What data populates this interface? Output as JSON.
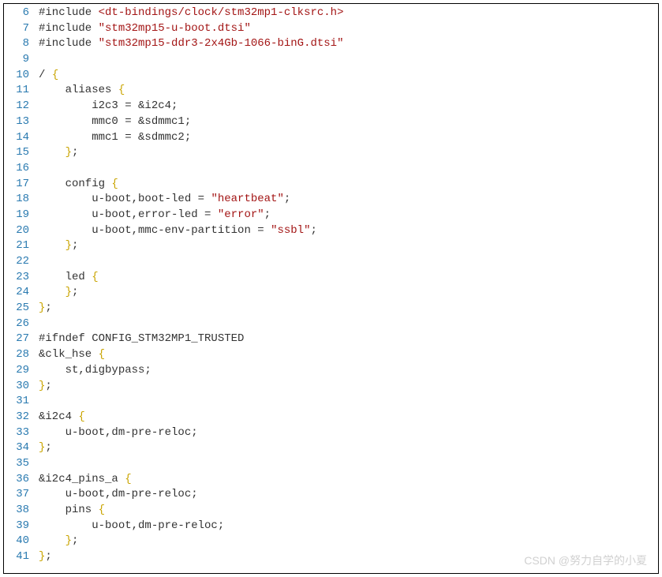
{
  "watermark": "CSDN @努力自学的小夏",
  "lines": [
    {
      "num": "6",
      "tokens": [
        {
          "t": "#include ",
          "c": "tok-pp"
        },
        {
          "t": "<dt-bindings/clock/stm32mp1-clksrc.h>",
          "c": "tok-inc"
        }
      ]
    },
    {
      "num": "7",
      "tokens": [
        {
          "t": "#include ",
          "c": "tok-pp"
        },
        {
          "t": "\"stm32mp15-u-boot.dtsi\"",
          "c": "tok-inc"
        }
      ]
    },
    {
      "num": "8",
      "tokens": [
        {
          "t": "#include ",
          "c": "tok-pp"
        },
        {
          "t": "\"stm32mp15-ddr3-2x4Gb-1066-binG.dtsi\"",
          "c": "tok-inc"
        }
      ]
    },
    {
      "num": "9",
      "tokens": []
    },
    {
      "num": "10",
      "tokens": [
        {
          "t": "/ ",
          "c": "tok-id"
        },
        {
          "t": "{",
          "c": "tok-brace"
        }
      ]
    },
    {
      "num": "11",
      "tokens": [
        {
          "t": "    aliases ",
          "c": "tok-id"
        },
        {
          "t": "{",
          "c": "tok-brace"
        }
      ]
    },
    {
      "num": "12",
      "tokens": [
        {
          "t": "        i2c3 = &i2c4;",
          "c": "tok-id"
        }
      ]
    },
    {
      "num": "13",
      "tokens": [
        {
          "t": "        mmc0 = &sdmmc1;",
          "c": "tok-id"
        }
      ]
    },
    {
      "num": "14",
      "tokens": [
        {
          "t": "        mmc1 = &sdmmc2;",
          "c": "tok-id"
        }
      ]
    },
    {
      "num": "15",
      "tokens": [
        {
          "t": "    ",
          "c": "tok-id"
        },
        {
          "t": "}",
          "c": "tok-brace"
        },
        {
          "t": ";",
          "c": "tok-punc"
        }
      ]
    },
    {
      "num": "16",
      "tokens": []
    },
    {
      "num": "17",
      "tokens": [
        {
          "t": "    config ",
          "c": "tok-id"
        },
        {
          "t": "{",
          "c": "tok-brace"
        }
      ]
    },
    {
      "num": "18",
      "tokens": [
        {
          "t": "        u-boot,boot-led = ",
          "c": "tok-id"
        },
        {
          "t": "\"heartbeat\"",
          "c": "tok-str"
        },
        {
          "t": ";",
          "c": "tok-punc"
        }
      ]
    },
    {
      "num": "19",
      "tokens": [
        {
          "t": "        u-boot,error-led = ",
          "c": "tok-id"
        },
        {
          "t": "\"error\"",
          "c": "tok-str"
        },
        {
          "t": ";",
          "c": "tok-punc"
        }
      ]
    },
    {
      "num": "20",
      "tokens": [
        {
          "t": "        u-boot,mmc-env-partition = ",
          "c": "tok-id"
        },
        {
          "t": "\"ssbl\"",
          "c": "tok-str"
        },
        {
          "t": ";",
          "c": "tok-punc"
        }
      ]
    },
    {
      "num": "21",
      "tokens": [
        {
          "t": "    ",
          "c": "tok-id"
        },
        {
          "t": "}",
          "c": "tok-brace"
        },
        {
          "t": ";",
          "c": "tok-punc"
        }
      ]
    },
    {
      "num": "22",
      "tokens": []
    },
    {
      "num": "23",
      "tokens": [
        {
          "t": "    led ",
          "c": "tok-id"
        },
        {
          "t": "{",
          "c": "tok-brace"
        }
      ]
    },
    {
      "num": "24",
      "tokens": [
        {
          "t": "    ",
          "c": "tok-id"
        },
        {
          "t": "}",
          "c": "tok-brace"
        },
        {
          "t": ";",
          "c": "tok-punc"
        }
      ]
    },
    {
      "num": "25",
      "tokens": [
        {
          "t": "",
          "c": "tok-id"
        },
        {
          "t": "}",
          "c": "tok-brace"
        },
        {
          "t": ";",
          "c": "tok-punc"
        }
      ]
    },
    {
      "num": "26",
      "tokens": []
    },
    {
      "num": "27",
      "tokens": [
        {
          "t": "#ifndef CONFIG_STM32MP1_TRUSTED",
          "c": "tok-pp"
        }
      ]
    },
    {
      "num": "28",
      "tokens": [
        {
          "t": "&clk_hse ",
          "c": "tok-id"
        },
        {
          "t": "{",
          "c": "tok-brace"
        }
      ]
    },
    {
      "num": "29",
      "tokens": [
        {
          "t": "    st,digbypass;",
          "c": "tok-id"
        }
      ]
    },
    {
      "num": "30",
      "tokens": [
        {
          "t": "}",
          "c": "tok-brace"
        },
        {
          "t": ";",
          "c": "tok-punc"
        }
      ]
    },
    {
      "num": "31",
      "tokens": []
    },
    {
      "num": "32",
      "tokens": [
        {
          "t": "&i2c4 ",
          "c": "tok-id"
        },
        {
          "t": "{",
          "c": "tok-brace"
        }
      ]
    },
    {
      "num": "33",
      "tokens": [
        {
          "t": "    u-boot,dm-pre-reloc;",
          "c": "tok-id"
        }
      ]
    },
    {
      "num": "34",
      "tokens": [
        {
          "t": "}",
          "c": "tok-brace"
        },
        {
          "t": ";",
          "c": "tok-punc"
        }
      ]
    },
    {
      "num": "35",
      "tokens": []
    },
    {
      "num": "36",
      "tokens": [
        {
          "t": "&i2c4_pins_a ",
          "c": "tok-id"
        },
        {
          "t": "{",
          "c": "tok-brace"
        }
      ]
    },
    {
      "num": "37",
      "tokens": [
        {
          "t": "    u-boot,dm-pre-reloc;",
          "c": "tok-id"
        }
      ]
    },
    {
      "num": "38",
      "tokens": [
        {
          "t": "    pins ",
          "c": "tok-id"
        },
        {
          "t": "{",
          "c": "tok-brace"
        }
      ]
    },
    {
      "num": "39",
      "tokens": [
        {
          "t": "        u-boot,dm-pre-reloc;",
          "c": "tok-id"
        }
      ]
    },
    {
      "num": "40",
      "tokens": [
        {
          "t": "    ",
          "c": "tok-id"
        },
        {
          "t": "}",
          "c": "tok-brace"
        },
        {
          "t": ";",
          "c": "tok-punc"
        }
      ]
    },
    {
      "num": "41",
      "tokens": [
        {
          "t": "}",
          "c": "tok-brace"
        },
        {
          "t": ";",
          "c": "tok-punc"
        }
      ]
    }
  ]
}
